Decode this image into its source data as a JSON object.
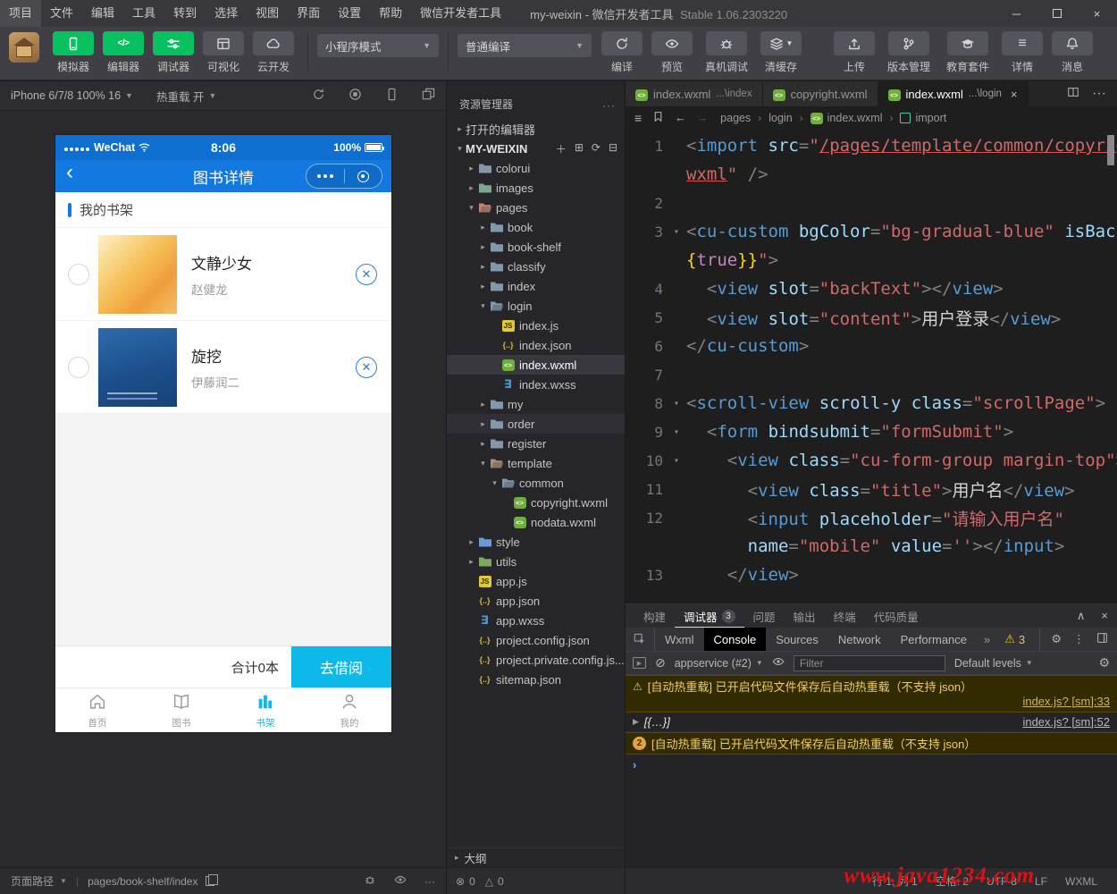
{
  "window": {
    "menu_items": [
      "项目",
      "文件",
      "编辑",
      "工具",
      "转到",
      "选择",
      "视图",
      "界面",
      "设置",
      "帮助",
      "微信开发者工具"
    ],
    "title_main": "my-weixin - 微信开发者工具",
    "title_version": "Stable 1.06.2303220"
  },
  "toolbar": {
    "view_buttons": [
      {
        "label": "模拟器",
        "icon": "phone",
        "active": true
      },
      {
        "label": "编辑器",
        "icon": "code",
        "active": true
      },
      {
        "label": "调试器",
        "icon": "sliders",
        "active": true
      },
      {
        "label": "可视化",
        "icon": "grid",
        "active": false
      },
      {
        "label": "云开发",
        "icon": "cloud",
        "active": false
      }
    ],
    "mode_select": "小程序模式",
    "compile_select": "普通编译",
    "compile_buttons": [
      {
        "label": "编译",
        "icon": "refresh"
      },
      {
        "label": "预览",
        "icon": "eye"
      },
      {
        "label": "真机调试",
        "icon": "bug"
      },
      {
        "label": "清缓存",
        "icon": "layers",
        "caret": true
      }
    ],
    "right_buttons": [
      {
        "label": "上传",
        "icon": "upload"
      },
      {
        "label": "版本管理",
        "icon": "branch"
      },
      {
        "label": "教育套件",
        "icon": "cap"
      },
      {
        "label": "详情",
        "icon": "menu"
      },
      {
        "label": "消息",
        "icon": "bell"
      }
    ]
  },
  "simulator": {
    "device_label": "iPhone 6/7/8 100% 16",
    "hot_reload_label": "热重载 开",
    "phone": {
      "carrier": "WeChat",
      "time": "8:06",
      "battery": "100%",
      "nav_title": "图书详情",
      "section_title": "我的书架",
      "books": [
        {
          "title": "文静少女",
          "author": "赵健龙",
          "cover": "orange"
        },
        {
          "title": "旋挖",
          "author": "伊藤润二",
          "cover": "blue"
        }
      ],
      "total_label": "合计0本",
      "borrow_button": "去借阅",
      "tab_bar": [
        {
          "label": "首页",
          "icon": "home",
          "active": false
        },
        {
          "label": "图书",
          "icon": "book",
          "active": false
        },
        {
          "label": "书架",
          "icon": "shelf",
          "active": true
        },
        {
          "label": "我的",
          "icon": "user",
          "active": false
        }
      ]
    }
  },
  "explorer": {
    "title": "资源管理器",
    "tree": [
      {
        "label": "打开的编辑器",
        "level": 0,
        "chev": "closed",
        "kind": "section"
      },
      {
        "label": "MY-WEIXIN",
        "level": 0,
        "chev": "open",
        "kind": "root"
      },
      {
        "label": "colorui",
        "level": 1,
        "chev": "closed",
        "icon": "fd",
        "color": "#8298ab"
      },
      {
        "label": "images",
        "level": 1,
        "chev": "closed",
        "icon": "fd",
        "color": "#79a98b"
      },
      {
        "label": "pages",
        "level": 1,
        "chev": "open",
        "icon": "fo",
        "color": "#c08874"
      },
      {
        "label": "book",
        "level": 2,
        "chev": "closed",
        "icon": "fd",
        "color": "#8298ab"
      },
      {
        "label": "book-shelf",
        "level": 2,
        "chev": "closed",
        "icon": "fd",
        "color": "#8298ab"
      },
      {
        "label": "classify",
        "level": 2,
        "chev": "closed",
        "icon": "fd",
        "color": "#8298ab"
      },
      {
        "label": "index",
        "level": 2,
        "chev": "closed",
        "icon": "fd",
        "color": "#8298ab"
      },
      {
        "label": "login",
        "level": 2,
        "chev": "open",
        "icon": "fo",
        "color": "#8298ab"
      },
      {
        "label": "index.js",
        "level": 3,
        "icon": "js"
      },
      {
        "label": "index.json",
        "level": 3,
        "icon": "json"
      },
      {
        "label": "index.wxml",
        "level": 3,
        "icon": "wxml",
        "selected": true
      },
      {
        "label": "index.wxss",
        "level": 3,
        "icon": "wxss"
      },
      {
        "label": "my",
        "level": 2,
        "chev": "closed",
        "icon": "fd",
        "color": "#8298ab"
      },
      {
        "label": "order",
        "level": 2,
        "chev": "closed",
        "icon": "fd",
        "color": "#8298ab",
        "hover": true
      },
      {
        "label": "register",
        "level": 2,
        "chev": "closed",
        "icon": "fd",
        "color": "#8298ab"
      },
      {
        "label": "template",
        "level": 2,
        "chev": "open",
        "icon": "fo",
        "color": "#a8907c"
      },
      {
        "label": "common",
        "level": 3,
        "chev": "open",
        "icon": "fo",
        "color": "#8298ab"
      },
      {
        "label": "copyright.wxml",
        "level": 4,
        "icon": "wxml"
      },
      {
        "label": "nodata.wxml",
        "level": 4,
        "icon": "wxml"
      },
      {
        "label": "style",
        "level": 1,
        "chev": "closed",
        "icon": "fd",
        "color": "#6b9bd2"
      },
      {
        "label": "utils",
        "level": 1,
        "chev": "closed",
        "icon": "fd",
        "color": "#7cab60"
      },
      {
        "label": "app.js",
        "level": 1,
        "icon": "js"
      },
      {
        "label": "app.json",
        "level": 1,
        "icon": "json"
      },
      {
        "label": "app.wxss",
        "level": 1,
        "icon": "wxss"
      },
      {
        "label": "project.config.json",
        "level": 1,
        "icon": "json"
      },
      {
        "label": "project.private.config.js...",
        "level": 1,
        "icon": "json"
      },
      {
        "label": "sitemap.json",
        "level": 1,
        "icon": "json"
      }
    ],
    "outline_label": "大纲",
    "error_count": "0",
    "warning_count": "0"
  },
  "editor": {
    "tabs": [
      {
        "name": "index.wxml",
        "hint": "...\\index",
        "active": false
      },
      {
        "name": "copyright.wxml",
        "hint": "",
        "active": false
      },
      {
        "name": "index.wxml",
        "hint": "...\\login",
        "active": true
      }
    ],
    "breadcrumbs": [
      {
        "label": "pages",
        "icon": ""
      },
      {
        "label": "login",
        "icon": ""
      },
      {
        "label": "index.wxml",
        "icon": "wxml"
      },
      {
        "label": "import",
        "icon": "symbol"
      }
    ],
    "code_rows": [
      {
        "n": "1",
        "f": 0,
        "tk": [
          [
            "<",
            "p"
          ],
          [
            "import",
            "t"
          ],
          [
            " ",
            "x"
          ],
          [
            "src",
            "a"
          ],
          [
            "=",
            "p"
          ],
          [
            "\"",
            "s"
          ],
          [
            "/pages/template/common/copyright.",
            "u"
          ]
        ]
      },
      {
        "n": "",
        "f": 0,
        "tk": [
          [
            "wxml",
            "u"
          ],
          [
            "\"",
            "s"
          ],
          [
            " ",
            "x"
          ],
          [
            "/>",
            "p"
          ]
        ]
      },
      {
        "n": "2",
        "f": 0,
        "tk": []
      },
      {
        "n": "3",
        "f": 1,
        "tk": [
          [
            "<",
            "p"
          ],
          [
            "cu-custom",
            "t"
          ],
          [
            " ",
            "x"
          ],
          [
            "bgColor",
            "a"
          ],
          [
            "=",
            "p"
          ],
          [
            "\"bg-gradual-blue\"",
            "s"
          ],
          [
            " ",
            "x"
          ],
          [
            "isBack",
            "a"
          ],
          [
            "=",
            "p"
          ],
          [
            "\"",
            "s"
          ],
          [
            "{",
            "b"
          ]
        ]
      },
      {
        "n": "",
        "f": 0,
        "tk": [
          [
            "{",
            "b"
          ],
          [
            "true",
            "k"
          ],
          [
            "}}",
            "b"
          ],
          [
            "\"",
            "s"
          ],
          [
            ">",
            "p"
          ]
        ]
      },
      {
        "n": "4",
        "f": 0,
        "tk": [
          [
            "  ",
            "x"
          ],
          [
            "<",
            "p"
          ],
          [
            "view",
            "t"
          ],
          [
            " ",
            "x"
          ],
          [
            "slot",
            "a"
          ],
          [
            "=",
            "p"
          ],
          [
            "\"backText\"",
            "s"
          ],
          [
            "></",
            "p"
          ],
          [
            "view",
            "t"
          ],
          [
            ">",
            "p"
          ]
        ]
      },
      {
        "n": "5",
        "f": 0,
        "tk": [
          [
            "  ",
            "x"
          ],
          [
            "<",
            "p"
          ],
          [
            "view",
            "t"
          ],
          [
            " ",
            "x"
          ],
          [
            "slot",
            "a"
          ],
          [
            "=",
            "p"
          ],
          [
            "\"content\"",
            "s"
          ],
          [
            ">",
            "p"
          ],
          [
            "用户登录",
            "x"
          ],
          [
            "</",
            "p"
          ],
          [
            "view",
            "t"
          ],
          [
            ">",
            "p"
          ]
        ]
      },
      {
        "n": "6",
        "f": 0,
        "tk": [
          [
            "</",
            "p"
          ],
          [
            "cu-custom",
            "t"
          ],
          [
            ">",
            "p"
          ]
        ]
      },
      {
        "n": "7",
        "f": 0,
        "tk": []
      },
      {
        "n": "8",
        "f": 1,
        "tk": [
          [
            "<",
            "p"
          ],
          [
            "scroll-view",
            "t"
          ],
          [
            " ",
            "x"
          ],
          [
            "scroll-y",
            "a"
          ],
          [
            " ",
            "x"
          ],
          [
            "class",
            "a"
          ],
          [
            "=",
            "p"
          ],
          [
            "\"scrollPage\"",
            "s"
          ],
          [
            ">",
            "p"
          ]
        ]
      },
      {
        "n": "9",
        "f": 1,
        "tk": [
          [
            "  ",
            "x"
          ],
          [
            "<",
            "p"
          ],
          [
            "form",
            "t"
          ],
          [
            " ",
            "x"
          ],
          [
            "bindsubmit",
            "a"
          ],
          [
            "=",
            "p"
          ],
          [
            "\"formSubmit\"",
            "s"
          ],
          [
            ">",
            "p"
          ]
        ]
      },
      {
        "n": "10",
        "f": 1,
        "tk": [
          [
            "    ",
            "x"
          ],
          [
            "<",
            "p"
          ],
          [
            "view",
            "t"
          ],
          [
            " ",
            "x"
          ],
          [
            "class",
            "a"
          ],
          [
            "=",
            "p"
          ],
          [
            "\"cu-form-group margin-top\"",
            "s"
          ],
          [
            ">",
            "p"
          ]
        ]
      },
      {
        "n": "11",
        "f": 0,
        "tk": [
          [
            "      ",
            "x"
          ],
          [
            "<",
            "p"
          ],
          [
            "view",
            "t"
          ],
          [
            " ",
            "x"
          ],
          [
            "class",
            "a"
          ],
          [
            "=",
            "p"
          ],
          [
            "\"title\"",
            "s"
          ],
          [
            ">",
            "p"
          ],
          [
            "用户名",
            "x"
          ],
          [
            "</",
            "p"
          ],
          [
            "view",
            "t"
          ],
          [
            ">",
            "p"
          ]
        ]
      },
      {
        "n": "12",
        "f": 0,
        "tk": [
          [
            "      ",
            "x"
          ],
          [
            "<",
            "p"
          ],
          [
            "input",
            "t"
          ],
          [
            " ",
            "x"
          ],
          [
            "placeholder",
            "a"
          ],
          [
            "=",
            "p"
          ],
          [
            "\"请输入用户名\"",
            "s"
          ]
        ]
      },
      {
        "n": "",
        "f": 0,
        "tk": [
          [
            "      ",
            "x"
          ],
          [
            "name",
            "a"
          ],
          [
            "=",
            "p"
          ],
          [
            "\"mobile\"",
            "s"
          ],
          [
            " ",
            "x"
          ],
          [
            "value",
            "a"
          ],
          [
            "=",
            "p"
          ],
          [
            "''",
            "s"
          ],
          [
            "></",
            "p"
          ],
          [
            "input",
            "t"
          ],
          [
            ">",
            "p"
          ]
        ]
      },
      {
        "n": "13",
        "f": 0,
        "tk": [
          [
            "    ",
            "x"
          ],
          [
            "</",
            "p"
          ],
          [
            "view",
            "t"
          ],
          [
            ">",
            "p"
          ]
        ]
      }
    ]
  },
  "debugger": {
    "panel_tabs": [
      {
        "label": "构建"
      },
      {
        "label": "调试器",
        "active": true,
        "badge": "3"
      },
      {
        "label": "问题"
      },
      {
        "label": "输出"
      },
      {
        "label": "终端"
      },
      {
        "label": "代码质量"
      }
    ],
    "devtools_tabs": [
      {
        "label": "Wxml"
      },
      {
        "label": "Console",
        "active": true
      },
      {
        "label": "Sources"
      },
      {
        "label": "Network"
      },
      {
        "label": "Performance"
      }
    ],
    "warning_badge": "3",
    "context_select": "appservice (#2)",
    "filter_placeholder": "Filter",
    "levels_select": "Default levels",
    "messages": [
      {
        "kind": "warn",
        "text": "[自动热重载] 已开启代码文件保存后自动热重载（不支持 json）",
        "source": "index.js? [sm]:33",
        "wrap_source": true
      },
      {
        "kind": "log",
        "text": "[{…}]",
        "source": "index.js? [sm]:52"
      },
      {
        "kind": "warn2",
        "badge": "2",
        "text": "[自动热重载] 已开启代码文件保存后自动热重载（不支持 json）",
        "source": ""
      }
    ]
  },
  "statusbar": {
    "page_path_label": "页面路径",
    "page_path": "pages/book-shelf/index",
    "right_items": [
      "行 1, 列 1",
      "空格: 2",
      "UTF-8",
      "LF",
      "WXML"
    ]
  },
  "watermark": "www.java1234.com"
}
